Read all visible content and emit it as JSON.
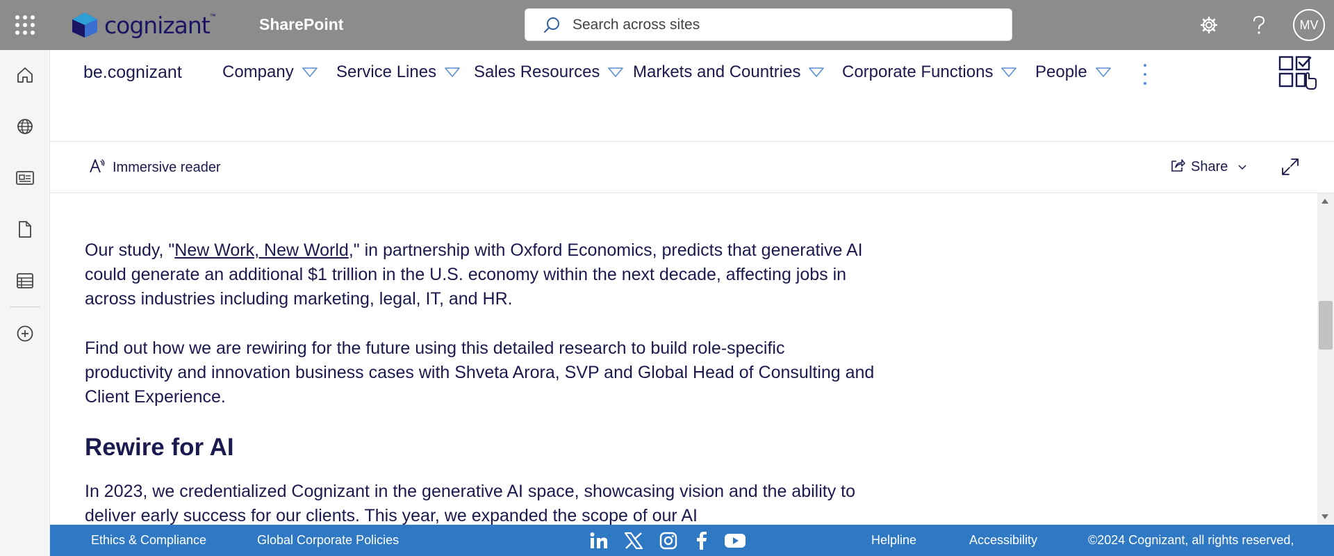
{
  "suite_bar": {
    "brand": "cognizant",
    "app_name": "SharePoint",
    "search_placeholder": "Search across sites",
    "avatar_initials": "MV"
  },
  "hub_nav": {
    "site_title": "be.cognizant",
    "items": [
      {
        "label": "Company"
      },
      {
        "label": "Service Lines"
      },
      {
        "label": "Sales Resources"
      },
      {
        "label": "Markets and Countries"
      },
      {
        "label": "Corporate Functions"
      },
      {
        "label": "People"
      }
    ],
    "ellipsis": "..."
  },
  "command_bar": {
    "immersive_reader": "Immersive reader",
    "share": "Share"
  },
  "content": {
    "p1_before": "Our study, \"",
    "p1_link": "New Work, New World",
    "p1_after": ",\" in partnership with Oxford Economics, predicts that generative AI could generate an additional $1 trillion in the U.S. economy within the next decade, affecting jobs in across industries including marketing, legal, IT, and HR.",
    "p2": "Find out how we are rewiring for the future using this detailed research to build role-specific productivity and innovation business cases with Shveta Arora, SVP and Global Head of Consulting and Client Experience.",
    "heading": "Rewire for AI",
    "p3": "In 2023, we credentialized Cognizant in the generative AI space, showcasing vision and the ability to deliver early success for our clients. This year, we expanded the scope of our AI"
  },
  "footer": {
    "ethics": "Ethics & Compliance",
    "policies": "Global Corporate Policies",
    "helpline": "Helpline",
    "accessibility": "Accessibility",
    "copyright": "©2024 Cognizant, all rights reserved,"
  },
  "colors": {
    "suite_bar": "#8c8c8c",
    "footer": "#2f78c4",
    "text": "#1b1a4e",
    "caret": "#5a8fd6"
  },
  "icons": {
    "waffle": "app-launcher-icon",
    "search": "search-icon",
    "settings": "gear-icon",
    "help": "help-icon",
    "home": "home-icon",
    "globe": "globe-icon",
    "news": "news-icon",
    "file": "file-icon",
    "list": "list-icon",
    "add": "add-icon"
  }
}
